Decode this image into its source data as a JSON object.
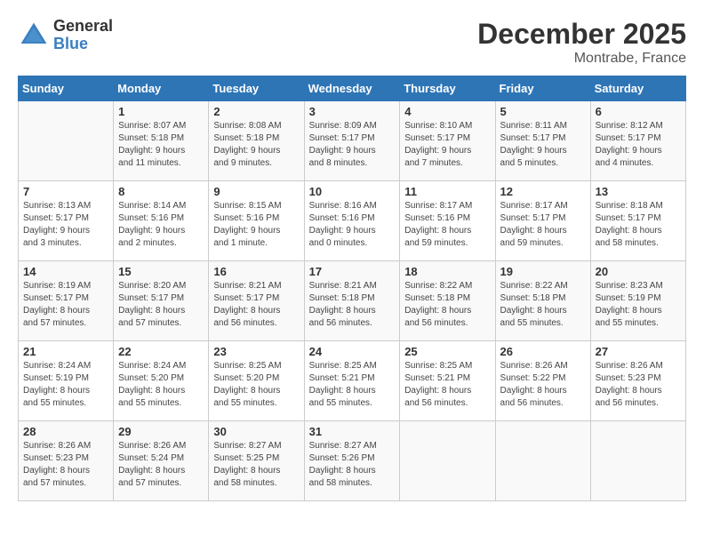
{
  "header": {
    "logo": {
      "line1": "General",
      "line2": "Blue"
    },
    "title": "December 2025",
    "subtitle": "Montrabe, France"
  },
  "weekdays": [
    "Sunday",
    "Monday",
    "Tuesday",
    "Wednesday",
    "Thursday",
    "Friday",
    "Saturday"
  ],
  "weeks": [
    [
      {
        "day": "",
        "info": ""
      },
      {
        "day": "1",
        "info": "Sunrise: 8:07 AM\nSunset: 5:18 PM\nDaylight: 9 hours\nand 11 minutes."
      },
      {
        "day": "2",
        "info": "Sunrise: 8:08 AM\nSunset: 5:18 PM\nDaylight: 9 hours\nand 9 minutes."
      },
      {
        "day": "3",
        "info": "Sunrise: 8:09 AM\nSunset: 5:17 PM\nDaylight: 9 hours\nand 8 minutes."
      },
      {
        "day": "4",
        "info": "Sunrise: 8:10 AM\nSunset: 5:17 PM\nDaylight: 9 hours\nand 7 minutes."
      },
      {
        "day": "5",
        "info": "Sunrise: 8:11 AM\nSunset: 5:17 PM\nDaylight: 9 hours\nand 5 minutes."
      },
      {
        "day": "6",
        "info": "Sunrise: 8:12 AM\nSunset: 5:17 PM\nDaylight: 9 hours\nand 4 minutes."
      }
    ],
    [
      {
        "day": "7",
        "info": "Sunrise: 8:13 AM\nSunset: 5:17 PM\nDaylight: 9 hours\nand 3 minutes."
      },
      {
        "day": "8",
        "info": "Sunrise: 8:14 AM\nSunset: 5:16 PM\nDaylight: 9 hours\nand 2 minutes."
      },
      {
        "day": "9",
        "info": "Sunrise: 8:15 AM\nSunset: 5:16 PM\nDaylight: 9 hours\nand 1 minute."
      },
      {
        "day": "10",
        "info": "Sunrise: 8:16 AM\nSunset: 5:16 PM\nDaylight: 9 hours\nand 0 minutes."
      },
      {
        "day": "11",
        "info": "Sunrise: 8:17 AM\nSunset: 5:16 PM\nDaylight: 8 hours\nand 59 minutes."
      },
      {
        "day": "12",
        "info": "Sunrise: 8:17 AM\nSunset: 5:17 PM\nDaylight: 8 hours\nand 59 minutes."
      },
      {
        "day": "13",
        "info": "Sunrise: 8:18 AM\nSunset: 5:17 PM\nDaylight: 8 hours\nand 58 minutes."
      }
    ],
    [
      {
        "day": "14",
        "info": "Sunrise: 8:19 AM\nSunset: 5:17 PM\nDaylight: 8 hours\nand 57 minutes."
      },
      {
        "day": "15",
        "info": "Sunrise: 8:20 AM\nSunset: 5:17 PM\nDaylight: 8 hours\nand 57 minutes."
      },
      {
        "day": "16",
        "info": "Sunrise: 8:21 AM\nSunset: 5:17 PM\nDaylight: 8 hours\nand 56 minutes."
      },
      {
        "day": "17",
        "info": "Sunrise: 8:21 AM\nSunset: 5:18 PM\nDaylight: 8 hours\nand 56 minutes."
      },
      {
        "day": "18",
        "info": "Sunrise: 8:22 AM\nSunset: 5:18 PM\nDaylight: 8 hours\nand 56 minutes."
      },
      {
        "day": "19",
        "info": "Sunrise: 8:22 AM\nSunset: 5:18 PM\nDaylight: 8 hours\nand 55 minutes."
      },
      {
        "day": "20",
        "info": "Sunrise: 8:23 AM\nSunset: 5:19 PM\nDaylight: 8 hours\nand 55 minutes."
      }
    ],
    [
      {
        "day": "21",
        "info": "Sunrise: 8:24 AM\nSunset: 5:19 PM\nDaylight: 8 hours\nand 55 minutes."
      },
      {
        "day": "22",
        "info": "Sunrise: 8:24 AM\nSunset: 5:20 PM\nDaylight: 8 hours\nand 55 minutes."
      },
      {
        "day": "23",
        "info": "Sunrise: 8:25 AM\nSunset: 5:20 PM\nDaylight: 8 hours\nand 55 minutes."
      },
      {
        "day": "24",
        "info": "Sunrise: 8:25 AM\nSunset: 5:21 PM\nDaylight: 8 hours\nand 55 minutes."
      },
      {
        "day": "25",
        "info": "Sunrise: 8:25 AM\nSunset: 5:21 PM\nDaylight: 8 hours\nand 56 minutes."
      },
      {
        "day": "26",
        "info": "Sunrise: 8:26 AM\nSunset: 5:22 PM\nDaylight: 8 hours\nand 56 minutes."
      },
      {
        "day": "27",
        "info": "Sunrise: 8:26 AM\nSunset: 5:23 PM\nDaylight: 8 hours\nand 56 minutes."
      }
    ],
    [
      {
        "day": "28",
        "info": "Sunrise: 8:26 AM\nSunset: 5:23 PM\nDaylight: 8 hours\nand 57 minutes."
      },
      {
        "day": "29",
        "info": "Sunrise: 8:26 AM\nSunset: 5:24 PM\nDaylight: 8 hours\nand 57 minutes."
      },
      {
        "day": "30",
        "info": "Sunrise: 8:27 AM\nSunset: 5:25 PM\nDaylight: 8 hours\nand 58 minutes."
      },
      {
        "day": "31",
        "info": "Sunrise: 8:27 AM\nSunset: 5:26 PM\nDaylight: 8 hours\nand 58 minutes."
      },
      {
        "day": "",
        "info": ""
      },
      {
        "day": "",
        "info": ""
      },
      {
        "day": "",
        "info": ""
      }
    ]
  ]
}
